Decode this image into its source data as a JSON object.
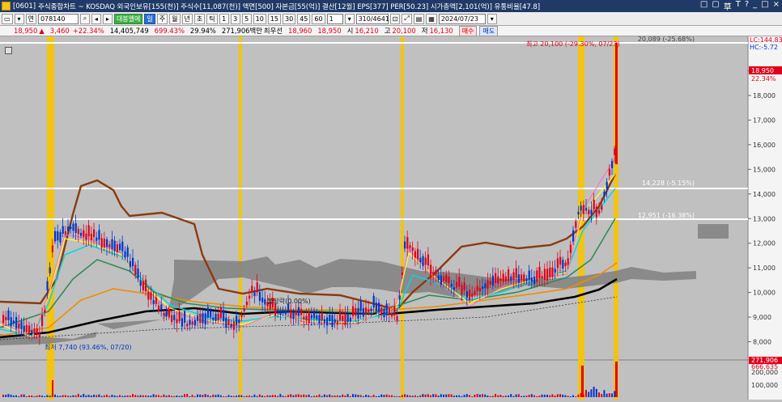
{
  "title": {
    "code": "[0601]",
    "text": "주식종합차트 ~ KOSDAQ 외국인보유[155(천)] 주식수[11,087(천)] 액면[500] 자본금[55(억)] 결산[12월] EPS[377] PER[50.23] 시가총액[2,101(억)] 유통비율[47.8]"
  },
  "window_controls": [
    "□",
    "▢",
    "草",
    "T",
    "?",
    "_",
    "□",
    "×"
  ],
  "toolbar": {
    "mode": "연",
    "code": "078140",
    "name_btn": "대봉엘에",
    "periods": [
      "일",
      "주",
      "월",
      "년",
      "초",
      "틱"
    ],
    "minutes": [
      "1",
      "3",
      "5",
      "10",
      "15",
      "30",
      "45",
      "60"
    ],
    "count": "1",
    "range": "310/4641",
    "date": "2024/07/23"
  },
  "pricebar": {
    "price": "18,950",
    "arrow": "▲",
    "change": "3,460",
    "rate": "+22.34%",
    "volume": "14,405,749",
    "vol_rate": "699.43%",
    "turnover": "29.94%",
    "amount": "271,906백만",
    "best_label": "최우선",
    "bid": "18,960",
    "ask": "18,950",
    "open_label": "시",
    "open": "16,210",
    "high_label": "고",
    "high": "20,100",
    "low_label": "저",
    "low": "16,130",
    "buy": "매수",
    "sell": "매도"
  },
  "chart": {
    "y_ticks": [
      "19,000",
      "18,000",
      "17,000",
      "16,000",
      "15,000",
      "14,000",
      "13,000",
      "12,000",
      "11,000",
      "10,000",
      "9,000",
      "8,000"
    ],
    "lc_label": "LC:144.83",
    "hc_label": "HC:-5.72",
    "cur_price": "18,950",
    "cur_rate": "22.34%",
    "hlines": [
      {
        "value": "20,089 (-25.68%)"
      },
      {
        "value": "14,228 (-5.15%)"
      },
      {
        "value": "12,951 (-16.38%)"
      }
    ],
    "high_annot": "최고 20,100 (-29.30%, 07/23)",
    "low_annot": "최저 7,740 (93.46%, 07/20)",
    "ma_label": "볼당락(0.00%)",
    "vol_label": "271,906",
    "vol_sub": "666,635",
    "vol_tick": "200,000",
    "vol_tick2": "100,000"
  },
  "colors": {
    "bull": "#e0001a",
    "bear": "#0035c9",
    "highlight": "#f7c400"
  }
}
